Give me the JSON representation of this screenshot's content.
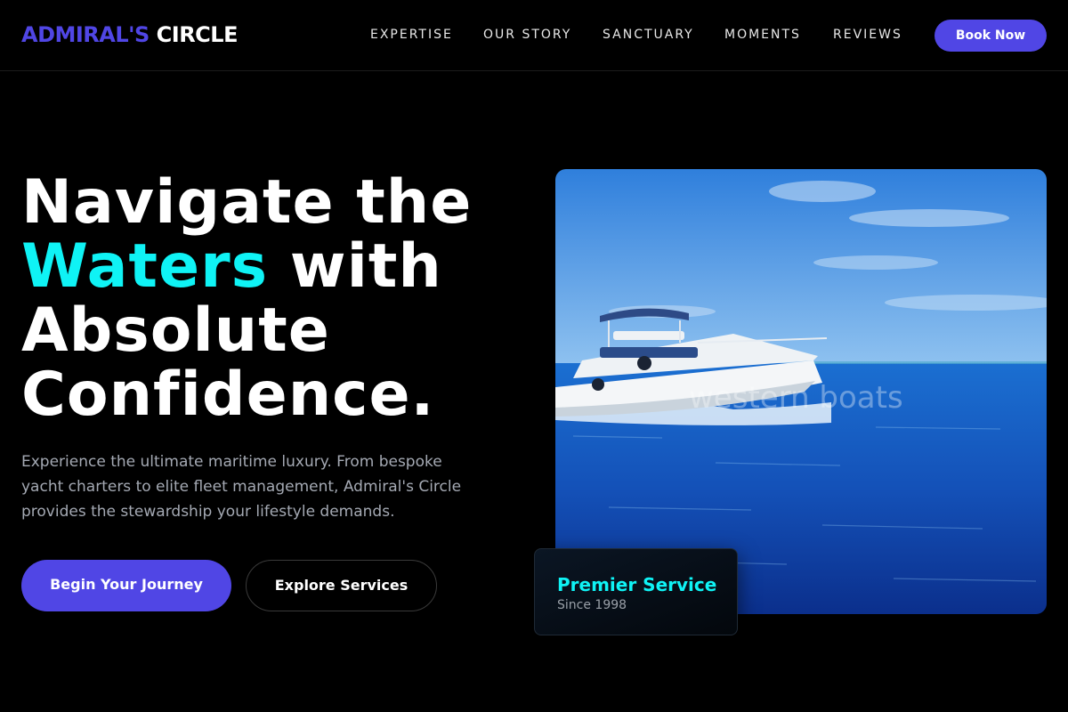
{
  "header": {
    "logo_part1": "ADMIRAL'S",
    "logo_part2": "CIRCLE",
    "nav": [
      "EXPERTISE",
      "OUR STORY",
      "SANCTUARY",
      "MOMENTS",
      "REVIEWS"
    ],
    "cta": "Book Now"
  },
  "hero": {
    "headline_line1": "Navigate the",
    "headline_accent": "Waters",
    "headline_line2_rest": " with",
    "headline_line3": "Absolute",
    "headline_line4": "Confidence.",
    "intro": "Experience the ultimate maritime luxury. From bespoke yacht charters to elite fleet management, Admiral's Circle provides the stewardship your lifestyle demands.",
    "primary_button": "Begin Your Journey",
    "secondary_button": "Explore Services",
    "image_watermark": "western boats"
  },
  "badge": {
    "title": "Premier Service",
    "subtitle": "Since 1998"
  },
  "colors": {
    "brand": "#5046e5",
    "accent": "#0ff3f5",
    "background": "#000000"
  }
}
